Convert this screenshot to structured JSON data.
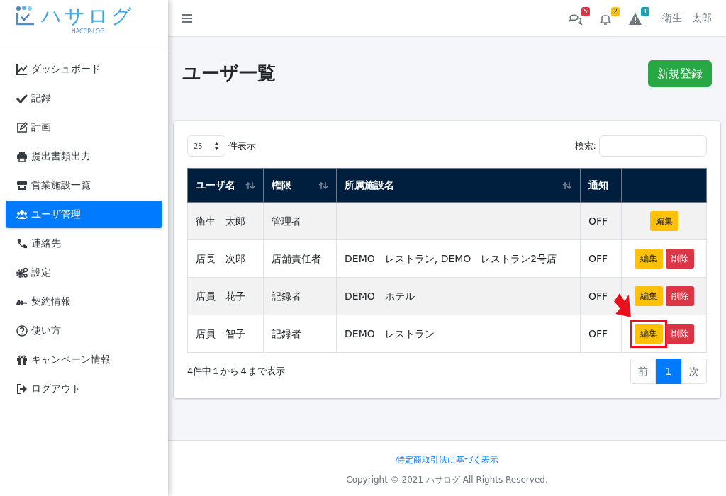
{
  "brand": {
    "name": "ハサログ",
    "subtitle": "HACCP-LOG"
  },
  "sidebar": {
    "items": [
      {
        "label": "ダッシュボード",
        "selected": false
      },
      {
        "label": "記録",
        "selected": false
      },
      {
        "label": "計画",
        "selected": false
      },
      {
        "label": "提出書類出力",
        "selected": false
      },
      {
        "label": "営業施設一覧",
        "selected": false
      },
      {
        "label": "ユーザ管理",
        "selected": true
      },
      {
        "label": "連絡先",
        "selected": false
      },
      {
        "label": "設定",
        "selected": false
      },
      {
        "label": "契約情報",
        "selected": false
      },
      {
        "label": "使い方",
        "selected": false
      },
      {
        "label": "キャンペーン情報",
        "selected": false
      },
      {
        "label": "ログアウト",
        "selected": false
      }
    ]
  },
  "topbar": {
    "notifications": [
      {
        "count": "5",
        "color": "#dc3545"
      },
      {
        "count": "2",
        "color": "#ffc107"
      },
      {
        "count": "1",
        "color": "#17a2b8"
      }
    ],
    "user": "衛生　太郎"
  },
  "page": {
    "title": "ユーザ一覧",
    "new_button": "新規登録"
  },
  "table_controls": {
    "page_size": "25",
    "page_size_label": "件表示",
    "search_label": "検索:"
  },
  "table": {
    "columns": [
      {
        "label": "ユーザ名",
        "sortable": true
      },
      {
        "label": "権限",
        "sortable": true
      },
      {
        "label": "所属施設名",
        "sortable": true
      },
      {
        "label": "通知",
        "sortable": false
      }
    ],
    "rows": [
      {
        "name": "衛生　太郎",
        "role": "管理者",
        "facility": "",
        "notify": "OFF",
        "actions": [
          {
            "kind": "edit",
            "label": "編集",
            "highlighted": false
          }
        ]
      },
      {
        "name": "店長　次郎",
        "role": "店舗責任者",
        "facility": "DEMO　レストラン, DEMO　レストラン2号店",
        "notify": "OFF",
        "actions": [
          {
            "kind": "edit",
            "label": "編集",
            "highlighted": false
          },
          {
            "kind": "delete",
            "label": "削除",
            "highlighted": false
          }
        ]
      },
      {
        "name": "店員　花子",
        "role": "記録者",
        "facility": "DEMO　ホテル",
        "notify": "OFF",
        "actions": [
          {
            "kind": "edit",
            "label": "編集",
            "highlighted": false
          },
          {
            "kind": "delete",
            "label": "削除",
            "highlighted": false
          }
        ]
      },
      {
        "name": "店員　智子",
        "role": "記録者",
        "facility": "DEMO　レストラン",
        "notify": "OFF",
        "actions": [
          {
            "kind": "edit",
            "label": "編集",
            "highlighted": true
          },
          {
            "kind": "delete",
            "label": "削除",
            "highlighted": false
          }
        ]
      }
    ]
  },
  "table_info": "4件中１から４まで表示",
  "pagination": [
    {
      "label": "前",
      "selected": false
    },
    {
      "label": "1",
      "selected": true
    },
    {
      "label": "次",
      "selected": false
    }
  ],
  "footer": {
    "link": "特定商取引法に基づく表示",
    "copyright": "Copyright © 2021 ハサログ All Rights Reserved."
  }
}
